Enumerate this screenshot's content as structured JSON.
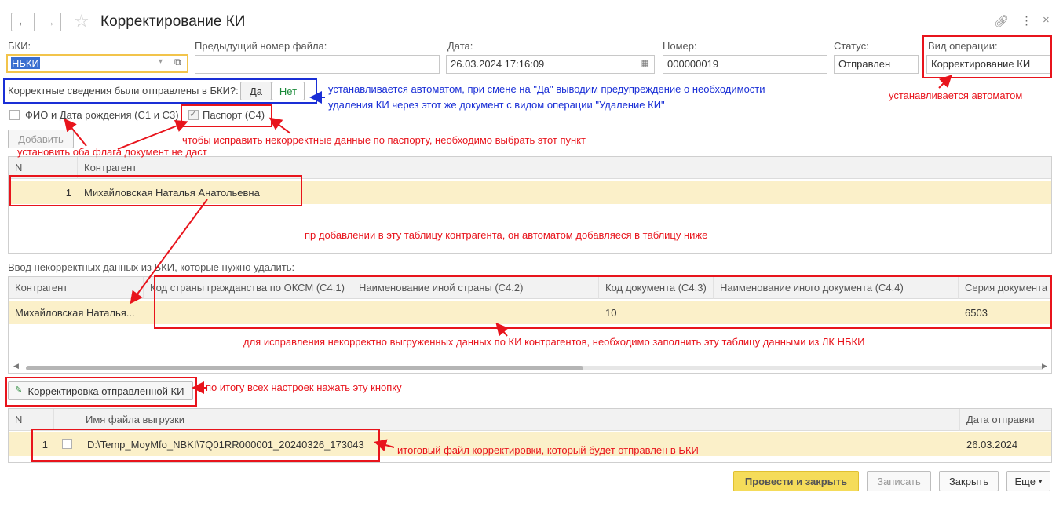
{
  "window": {
    "title": "Корректирование КИ"
  },
  "header": {
    "bki_label": "БКИ:",
    "bki_value": "НБКИ",
    "prev_file_label": "Предыдущий номер файла:",
    "prev_file_value": "",
    "date_label": "Дата:",
    "date_value": "26.03.2024 17:16:09",
    "number_label": "Номер:",
    "number_value": "000000019",
    "status_label": "Статус:",
    "status_value": "Отправлен",
    "op_label": "Вид операции:",
    "op_value": "Корректирование КИ"
  },
  "sent": {
    "question": "Корректные сведения были отправлены в БКИ?:",
    "yes_label": "Да",
    "no_label": "Нет"
  },
  "flags": {
    "fio_label": "ФИО и Дата рождения (С1 и С3)",
    "passport_label": "Паспорт (С4)",
    "passport_checked": true
  },
  "add_button": "Добавить",
  "table1": {
    "columns": [
      "N",
      "Контрагент"
    ],
    "rows": [
      {
        "n": "1",
        "name": "Михайловская Наталья Анатольевна"
      }
    ]
  },
  "section2_label": "Ввод некорректных данных из БКИ, которые нужно удалить:",
  "table2": {
    "columns": [
      "Контрагент",
      "Код страны гражданства по ОКСМ (С4.1)",
      "Наименование иной страны (С4.2)",
      "Код документа (С4.3)",
      "Наименование иного документа (С4.4)",
      "Серия документа"
    ],
    "rows": [
      {
        "name": "Михайловская Наталья...",
        "country_code": "",
        "country_name": "",
        "doc_code": "10",
        "doc_name": "",
        "series": "6503"
      }
    ]
  },
  "correct_button": "Корректировка отправленной КИ",
  "table3": {
    "columns": [
      "N",
      "",
      "Имя файла выгрузки",
      "Дата отправки"
    ],
    "rows": [
      {
        "n": "1",
        "file": "D:\\Temp_MoyMfo_NBKI\\7Q01RR000001_20240326_173043",
        "date": "26.03.2024"
      }
    ]
  },
  "footer": {
    "post_close": "Провести и закрыть",
    "save": "Записать",
    "close": "Закрыть",
    "more": "Еще"
  },
  "annotations": {
    "auto_sent_1": "устанавливается автоматом, при смене на \"Да\" выводим предупреждение о необходимости",
    "auto_sent_2": "удаления КИ через этот же документ с видом операции \"Удаление КИ\"",
    "auto_op": "устанавливается автоматом",
    "passport_hint": "чтобы исправить некорректные данные по паспорту, необходимо выбрать этот пункт",
    "both_flags": "установить оба флага документ не даст",
    "table1_hint": "пр добавлении в эту таблицу контрагента, он автоматом добавляеся в таблицу ниже",
    "table2_hint": "для исправления некорректно выгруженных данных по КИ контрагентов, необходимо заполнить эту таблицу данными из ЛК НБКИ",
    "button_hint": "по итогу всех настроек нажать эту кнопку",
    "file_hint": "итоговый файл корректировки, который будет отправлен в БКИ"
  },
  "colors": {
    "annotation_red": "#e8141c",
    "annotation_blue": "#1a2fd6",
    "row_highlight": "#fbf0c9",
    "primary_button": "#f5dc5a"
  }
}
